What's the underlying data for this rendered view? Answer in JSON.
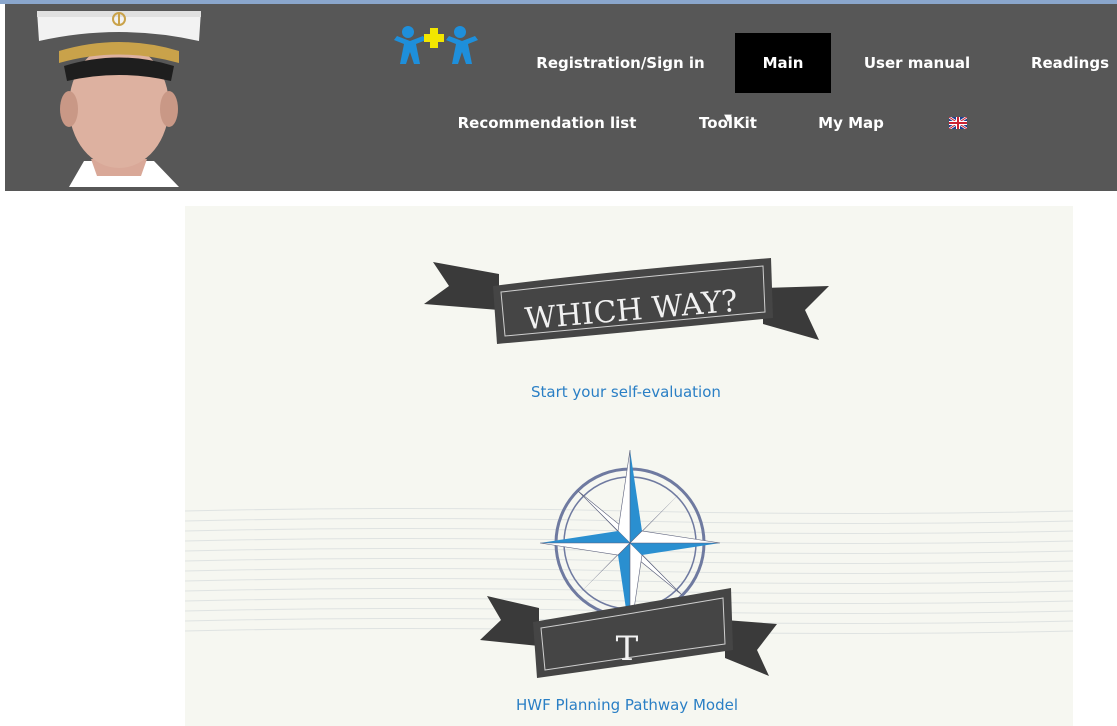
{
  "nav": {
    "registration_label": "Registration/Sign in",
    "main_label": "Main",
    "user_manual_label": "User manual",
    "readings_label": "Readings",
    "recommendation_label": "Recommendation list",
    "toolkit_label": "ToolKit",
    "toolkit_arrow": "▼",
    "my_map_label": "My Map",
    "language": "English (UK flag)"
  },
  "main": {
    "banner_text": "WHICH WAY?",
    "self_evaluation_link": "Start your self-evaluation",
    "compass_banner_text": "T",
    "pathway_link": "HWF Planning Pathway Model"
  },
  "colors": {
    "header_bg": "#575757",
    "active_nav": "#000000",
    "content_bg": "#f6f7f1",
    "link": "#2a7fc5",
    "logo_blue": "#1e8fdb",
    "logo_yellow": "#f2e600",
    "compass_blue": "#2a8fd0",
    "ribbon": "#3a3a3a"
  }
}
